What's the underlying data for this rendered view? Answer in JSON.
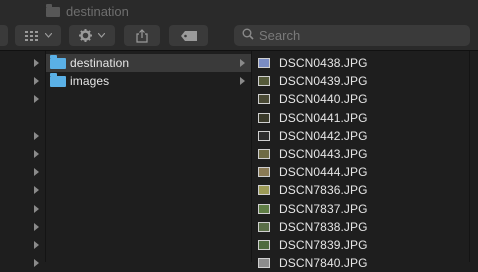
{
  "window": {
    "title": "destination"
  },
  "toolbar": {
    "view_icon": "grid-icon",
    "action_icon": "gear-icon",
    "share_icon": "share-icon",
    "tag_icon": "tag-icon",
    "search": {
      "placeholder": "Search",
      "value": ""
    }
  },
  "columns": {
    "col1": {
      "arrow_rows": [
        0,
        1,
        2,
        4,
        5,
        6,
        7,
        8,
        9,
        10,
        11
      ]
    },
    "col2": {
      "items": [
        {
          "label": "destination",
          "selected": true,
          "has_children": true
        },
        {
          "label": "images",
          "selected": false,
          "has_children": true
        }
      ]
    },
    "col3": {
      "items": [
        {
          "label": "DSCN0438.JPG",
          "thumb": "#7a8cc4"
        },
        {
          "label": "DSCN0439.JPG",
          "thumb": "#555a3a"
        },
        {
          "label": "DSCN0440.JPG",
          "thumb": "#4a4a35"
        },
        {
          "label": "DSCN0441.JPG",
          "thumb": "#3a3a2a"
        },
        {
          "label": "DSCN0442.JPG",
          "thumb": "#2e2e2e"
        },
        {
          "label": "DSCN0443.JPG",
          "thumb": "#6e6a44"
        },
        {
          "label": "DSCN0444.JPG",
          "thumb": "#8a7a55"
        },
        {
          "label": "DSCN7836.JPG",
          "thumb": "#9c9a56"
        },
        {
          "label": "DSCN7837.JPG",
          "thumb": "#5f7d45"
        },
        {
          "label": "DSCN7838.JPG",
          "thumb": "#5a6e48"
        },
        {
          "label": "DSCN7839.JPG",
          "thumb": "#4e6a3e"
        },
        {
          "label": "DSCN7840.JPG",
          "thumb": "#8c8c8c"
        }
      ]
    }
  }
}
